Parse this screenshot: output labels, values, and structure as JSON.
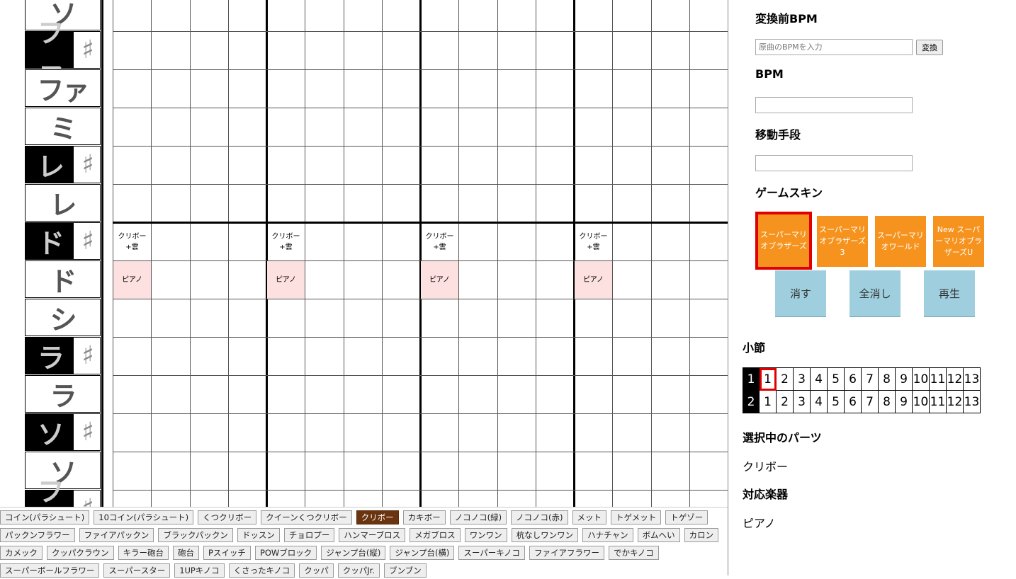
{
  "keys": [
    {
      "name": "ソ",
      "sharp": false
    },
    {
      "name": "ファ",
      "sharp": true
    },
    {
      "name": "ファ",
      "sharp": false
    },
    {
      "name": "ミ",
      "sharp": false
    },
    {
      "name": "レ",
      "sharp": true
    },
    {
      "name": "レ",
      "sharp": false
    },
    {
      "name": "ド",
      "sharp": true
    },
    {
      "name": "ド",
      "sharp": false
    },
    {
      "name": "シ",
      "sharp": false
    },
    {
      "name": "ラ",
      "sharp": true
    },
    {
      "name": "ラ",
      "sharp": false
    },
    {
      "name": "ソ",
      "sharp": true
    },
    {
      "name": "ソ",
      "sharp": false
    },
    {
      "name": "ファ",
      "sharp": true
    }
  ],
  "sharp_symbol": "♯",
  "grid": {
    "notes": [
      {
        "row": 6,
        "col": 0,
        "text": "クリボー\n+雲",
        "kind": "sound"
      },
      {
        "row": 6,
        "col": 4,
        "text": "クリボー\n+雲",
        "kind": "sound"
      },
      {
        "row": 6,
        "col": 8,
        "text": "クリボー\n+雲",
        "kind": "sound"
      },
      {
        "row": 6,
        "col": 12,
        "text": "クリボー\n+雲",
        "kind": "sound"
      },
      {
        "row": 7,
        "col": 0,
        "text": "ピアノ",
        "kind": "piano"
      },
      {
        "row": 7,
        "col": 4,
        "text": "ピアノ",
        "kind": "piano"
      },
      {
        "row": 7,
        "col": 8,
        "text": "ピアノ",
        "kind": "piano"
      },
      {
        "row": 7,
        "col": 12,
        "text": "ピアノ",
        "kind": "piano"
      }
    ]
  },
  "palette": [
    [
      "コイン(パラシュート)",
      "10コイン(パラシュート)",
      "くつクリボー",
      "クイーンくつクリボー",
      "クリボー",
      "カキボー",
      "ノコノコ(緑)",
      "ノコノコ(赤)",
      "メット",
      "トゲメット",
      "トゲゾー"
    ],
    [
      "パックンフラワー",
      "ファイアパックン",
      "ブラックパックン",
      "ドッスン",
      "チョロプー",
      "ハンマーブロス",
      "メガブロス",
      "ワンワン",
      "杭なしワンワン",
      "ハナチャン",
      "ボムへい",
      "カロン"
    ],
    [
      "カメック",
      "クッパクラウン",
      "キラー砲台",
      "砲台",
      "Pスイッチ",
      "POWブロック",
      "ジャンプ台(縦)",
      "ジャンプ台(横)",
      "スーパーキノコ",
      "ファイアフラワー",
      "でかキノコ"
    ],
    [
      "スーパーボールフラワー",
      "スーパースター",
      "1UPキノコ",
      "くさったキノコ",
      "クッパ",
      "クッパJr.",
      "ブンブン"
    ]
  ],
  "selected_part_index": 4,
  "panel": {
    "orig_bpm_title": "変換前BPM",
    "orig_bpm_placeholder": "原曲のBPMを入力",
    "convert_button": "変換",
    "bpm_title": "BPM",
    "bpm_value": "",
    "move_title": "移動手段",
    "move_value": "",
    "skin_title": "ゲームスキン",
    "skins": [
      "スーパーマリオブラザーズ",
      "スーパーマリオブラザーズ3",
      "スーパーマリオワールド",
      "New スーパーマリオブラザーズU"
    ],
    "selected_skin": 0,
    "erase_button": "消す",
    "clear_all_button": "全消し",
    "play_button": "再生",
    "measure_title": "小節",
    "measure_rows": [
      {
        "label": "1",
        "cells": [
          "1",
          "2",
          "3",
          "4",
          "5",
          "6",
          "7",
          "8",
          "9",
          "10",
          "11",
          "12",
          "13"
        ]
      },
      {
        "label": "2",
        "cells": [
          "1",
          "2",
          "3",
          "4",
          "5",
          "6",
          "7",
          "8",
          "9",
          "10",
          "11",
          "12",
          "13"
        ]
      }
    ],
    "current_measure": {
      "row": 0,
      "col": 0
    },
    "selected_part_title": "選択中のパーツ",
    "selected_part_value": "クリボー",
    "instrument_title": "対応楽器",
    "instrument_value": "ピアノ"
  }
}
